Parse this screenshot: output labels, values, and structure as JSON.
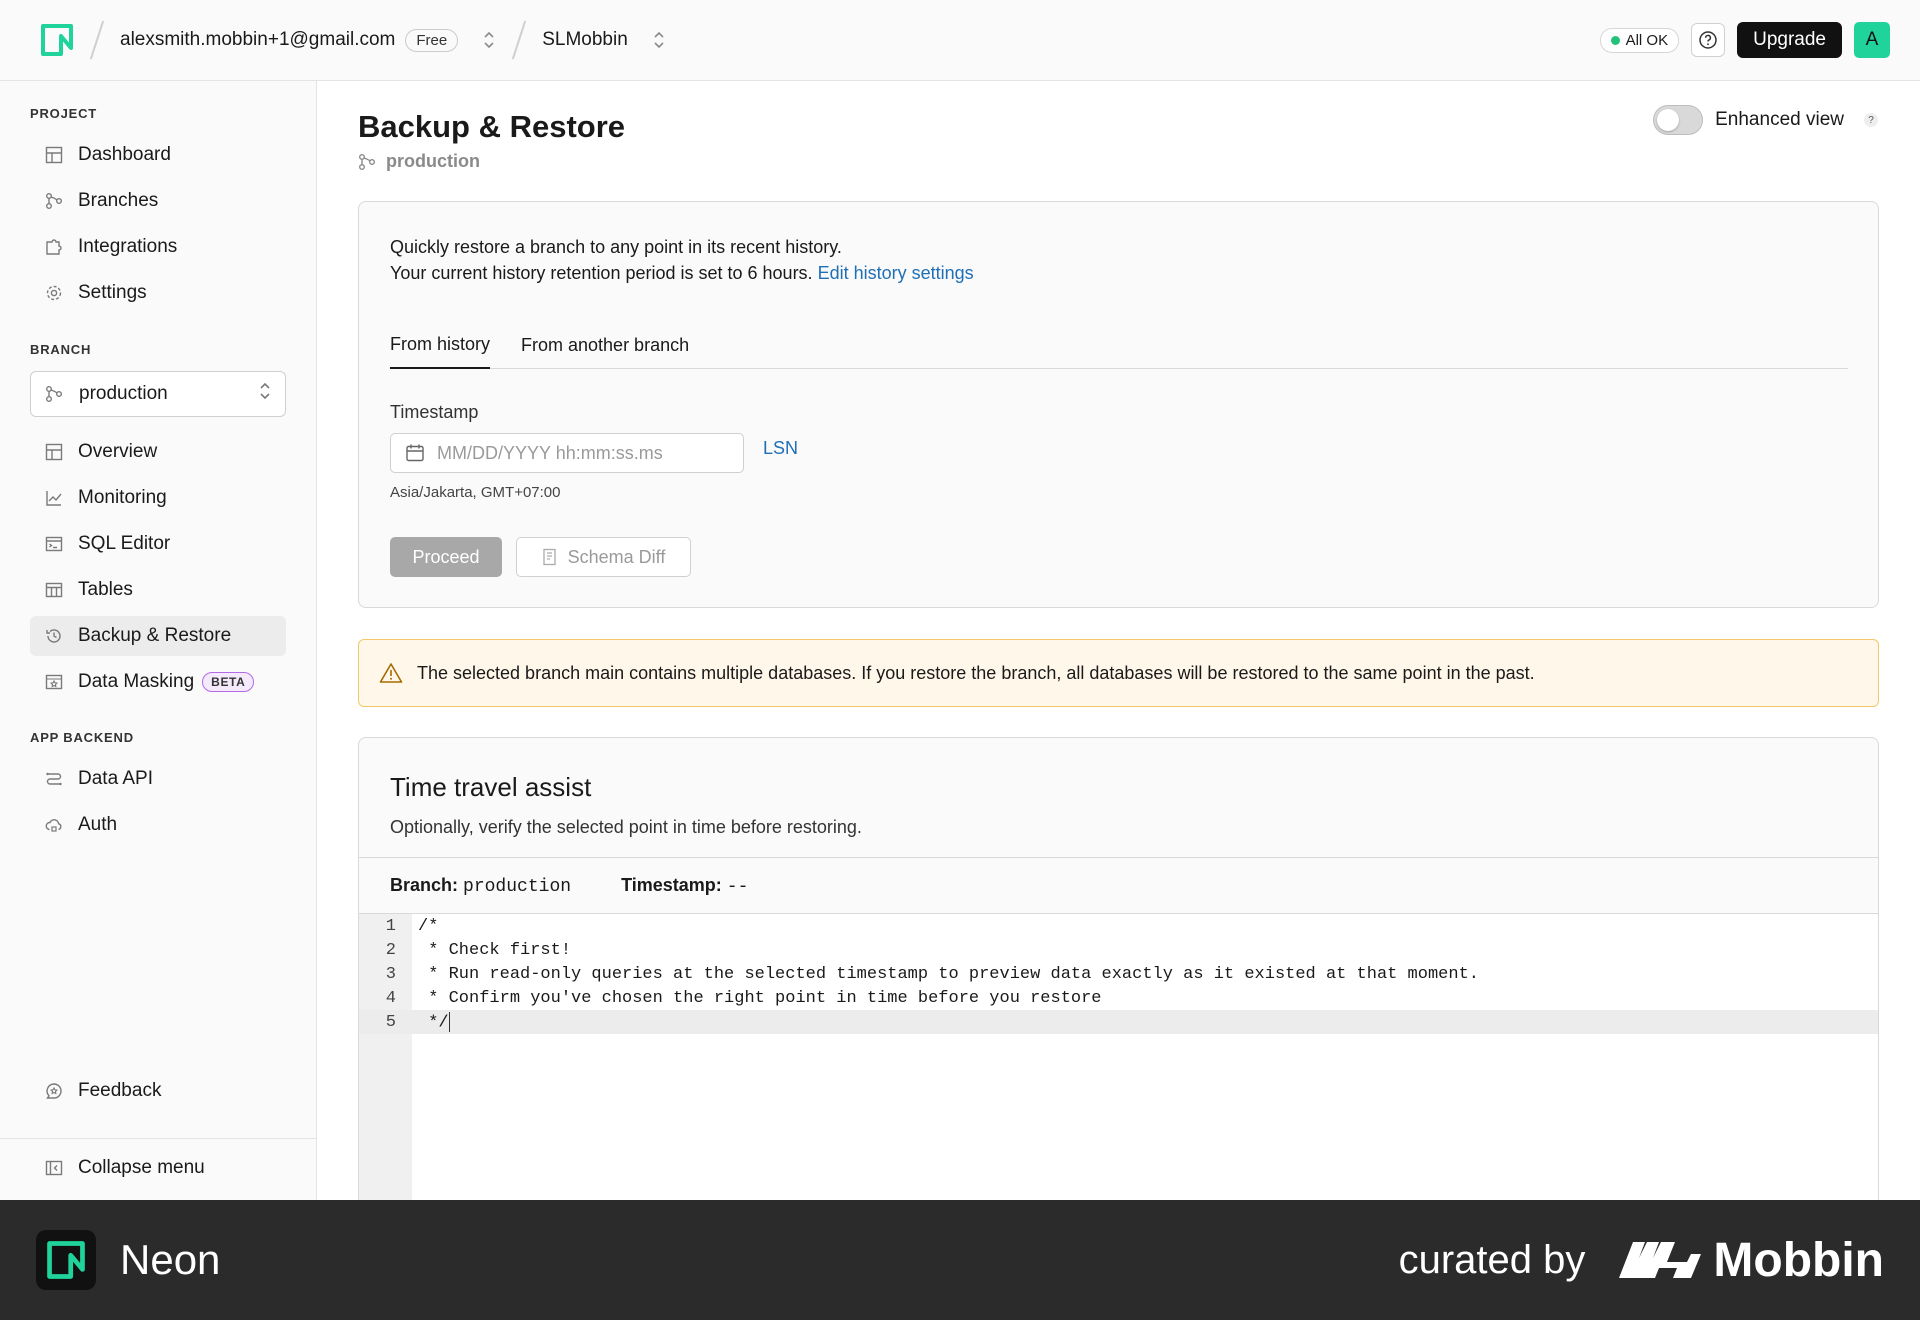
{
  "header": {
    "account_email": "alexsmith.mobbin+1@gmail.com",
    "plan_badge": "Free",
    "project_name": "SLMobbin",
    "status": "All OK",
    "upgrade_label": "Upgrade",
    "avatar_initial": "A",
    "accent_color": "#1fd39a"
  },
  "sidebar": {
    "project_label": "PROJECT",
    "project_items": [
      {
        "label": "Dashboard",
        "icon": "grid-icon"
      },
      {
        "label": "Branches",
        "icon": "branch-icon"
      },
      {
        "label": "Integrations",
        "icon": "puzzle-icon"
      },
      {
        "label": "Settings",
        "icon": "gear-icon"
      }
    ],
    "branch_label": "BRANCH",
    "branch_select": "production",
    "branch_items": [
      {
        "label": "Overview",
        "icon": "grid-icon"
      },
      {
        "label": "Monitoring",
        "icon": "chart-icon"
      },
      {
        "label": "SQL Editor",
        "icon": "terminal-icon"
      },
      {
        "label": "Tables",
        "icon": "table-icon"
      },
      {
        "label": "Backup & Restore",
        "icon": "history-icon",
        "active": true
      },
      {
        "label": "Data Masking",
        "icon": "mask-icon",
        "badge": "BETA"
      }
    ],
    "app_backend_label": "APP BACKEND",
    "backend_items": [
      {
        "label": "Data API",
        "icon": "api-icon"
      },
      {
        "label": "Auth",
        "icon": "cloud-lock-icon"
      }
    ],
    "feedback_label": "Feedback",
    "collapse_label": "Collapse menu"
  },
  "main": {
    "title": "Backup & Restore",
    "branch": "production",
    "enhanced_view_label": "Enhanced view",
    "enhanced_view_on": false,
    "intro_line1": "Quickly restore a branch to any point in its recent history.",
    "intro_line2": "Your current history retention period is set to 6 hours.",
    "edit_history_link": "Edit history settings",
    "tabs": [
      "From history",
      "From another branch"
    ],
    "active_tab": "From history",
    "timestamp_label": "Timestamp",
    "timestamp_placeholder": "MM/DD/YYYY hh:mm:ss.ms",
    "lsn_link": "LSN",
    "timezone": "Asia/Jakarta, GMT+07:00",
    "proceed_label": "Proceed",
    "schema_diff_label": "Schema Diff",
    "warning_text": "The selected branch main contains multiple databases. If you restore the branch, all databases will be restored to the same point in the past."
  },
  "time_travel": {
    "title": "Time travel assist",
    "subtitle": "Optionally, verify the selected point in time before restoring.",
    "branch_label": "Branch:",
    "branch_value": "production",
    "timestamp_label": "Timestamp:",
    "timestamp_value": "--",
    "code_lines": [
      {
        "n": "1",
        "text": "/*"
      },
      {
        "n": "2",
        "text": " * Check first!"
      },
      {
        "n": "3",
        "text": " * Run read-only queries at the selected timestamp to preview data exactly as it existed at that moment."
      },
      {
        "n": "4",
        "text": " * Confirm you've chosen the right point in time before you restore"
      },
      {
        "n": "5",
        "text": " */"
      }
    ]
  },
  "footer": {
    "brand": "Neon",
    "curated_by": "curated by",
    "curator": "Mobbin"
  }
}
